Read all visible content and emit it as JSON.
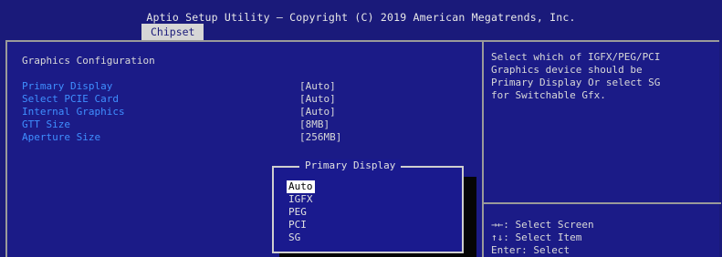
{
  "header": {
    "title": "Aptio Setup Utility – Copyright (C) 2019 American Megatrends, Inc.",
    "active_tab": "Chipset"
  },
  "section_title": "Graphics Configuration",
  "settings": [
    {
      "label": "Primary Display",
      "value": "[Auto]"
    },
    {
      "label": "Select PCIE Card",
      "value": "[Auto]"
    },
    {
      "label": "Internal Graphics",
      "value": "[Auto]"
    },
    {
      "label": "GTT Size",
      "value": "[8MB]"
    },
    {
      "label": "Aperture Size",
      "value": "[256MB]"
    }
  ],
  "help_text": "Select which of IGFX/PEG/PCI\nGraphics device should be\nPrimary Display Or select SG\nfor Switchable Gfx.",
  "key_hints": [
    "→←: Select Screen",
    "↑↓: Select Item",
    "Enter: Select"
  ],
  "popup": {
    "title": "Primary Display",
    "options": [
      "Auto",
      "IGFX",
      "PEG",
      "PCI",
      "SG"
    ],
    "selected": "Auto"
  },
  "colors": {
    "background": "#1b1b87",
    "label_blue": "#3f8fff",
    "text": "#d8d8d8",
    "tab_bg": "#d6d6d6"
  }
}
